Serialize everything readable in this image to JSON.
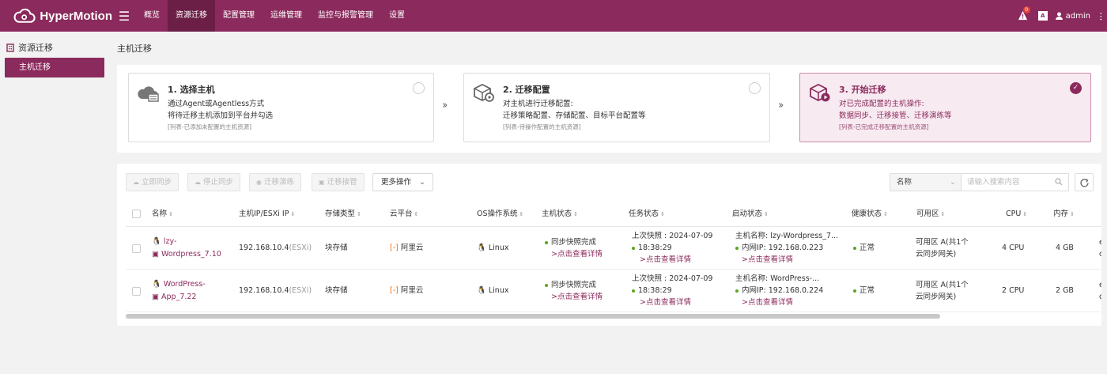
{
  "app": {
    "name": "HyperMotion"
  },
  "nav": [
    "概览",
    "资源迁移",
    "配置管理",
    "运维管理",
    "监控与报警管理",
    "设置"
  ],
  "header": {
    "alert_count": "0",
    "lang": "A",
    "user": "admin"
  },
  "sidebar": {
    "section": "资源迁移",
    "items": [
      "主机迁移"
    ]
  },
  "breadcrumb": "主机迁移",
  "steps": [
    {
      "title": "1. 选择主机",
      "line1": "通过Agent或Agentless方式",
      "line2": "将待迁移主机添加到平台并勾选",
      "note": "[列表-已添加未配置的主机资源]"
    },
    {
      "title": "2. 迁移配置",
      "line1": "对主机进行迁移配置:",
      "line2": "迁移策略配置、存储配置、目标平台配置等",
      "note": "[列表-待操作配置的主机资源]"
    },
    {
      "title": "3. 开始迁移",
      "line1": "对已完成配置的主机操作:",
      "line2": "数据同步、迁移接管、迁移演练等",
      "note": "[列表-已完成迁移配置的主机资源]"
    }
  ],
  "toolbar": {
    "sync_now": "立即同步",
    "stop_sync": "停止同步",
    "drill": "迁移演练",
    "takeover": "迁移接管",
    "more": "更多操作",
    "filter_field": "名称",
    "search_placeholder": "请输入搜索内容"
  },
  "table": {
    "columns": [
      "名称",
      "主机IP/ESXi IP",
      "存储类型",
      "云平台",
      "OS操作系统",
      "主机状态",
      "任务状态",
      "启动状态",
      "健康状态",
      "可用区",
      "CPU",
      "内存"
    ],
    "rows": [
      {
        "name_l1": "lzy-",
        "name_l2": "Wordpress_7.10",
        "ip": "192.168.10.4",
        "ip_suffix": "(ESXi)",
        "storage": "块存储",
        "cloud": "阿里云",
        "os": "Linux",
        "host_status": "同步快照完成",
        "host_link": ">点击查看详情",
        "task_l1": "上次快照 : 2024-07-09",
        "task_l2": "18:38:29",
        "task_link": ">点击查看详情",
        "boot_l1": "主机名称: lzy-Wordpress_7...",
        "boot_l2": "内网IP: 192.168.0.223",
        "boot_link": ">点击查看详情",
        "health": "正常",
        "zone_l1": "可用区 A(共1个",
        "zone_l2": "云同步网关)",
        "cpu": "4 CPU",
        "mem": "4 GB",
        "extra_l1": "e",
        "extra_l2": "c"
      },
      {
        "name_l1": "WordPress-",
        "name_l2": "App_7.22",
        "ip": "192.168.10.4",
        "ip_suffix": "(ESXi)",
        "storage": "块存储",
        "cloud": "阿里云",
        "os": "Linux",
        "host_status": "同步快照完成",
        "host_link": ">点击查看详情",
        "task_l1": "上次快照 : 2024-07-09",
        "task_l2": "18:38:29",
        "task_link": ">点击查看详情",
        "boot_l1": "主机名称: WordPress-...",
        "boot_l2": "内网IP: 192.168.0.224",
        "boot_link": ">点击查看详情",
        "health": "正常",
        "zone_l1": "可用区 A(共1个",
        "zone_l2": "云同步网关)",
        "cpu": "2 CPU",
        "mem": "2 GB",
        "extra_l1": "e",
        "extra_l2": "c"
      }
    ]
  },
  "colors": {
    "brand": "#8b2a5c",
    "brand_dark": "#6c1f46",
    "ok": "#5aa623"
  }
}
